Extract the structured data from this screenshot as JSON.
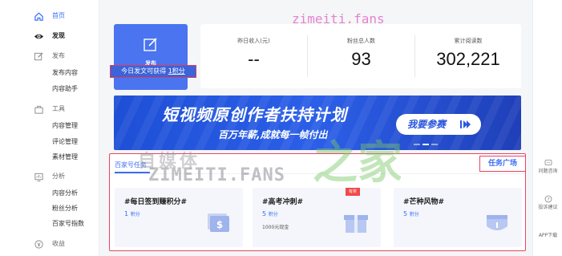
{
  "sidebar": {
    "items": [
      {
        "label": "首页",
        "icon": "home-icon",
        "style": "active"
      },
      {
        "label": "发现",
        "icon": "eye-icon",
        "style": "bold"
      },
      {
        "label": "发布",
        "icon": "edit-icon",
        "style": "head"
      },
      {
        "label": "发布内容",
        "style": "sub"
      },
      {
        "label": "内容助手",
        "style": "sub"
      },
      {
        "label": "工具",
        "icon": "briefcase-icon",
        "style": "head"
      },
      {
        "label": "内容管理",
        "style": "sub"
      },
      {
        "label": "评论管理",
        "style": "sub"
      },
      {
        "label": "素材管理",
        "style": "sub"
      },
      {
        "label": "分析",
        "icon": "chart-icon",
        "style": "head"
      },
      {
        "label": "内容分析",
        "style": "sub"
      },
      {
        "label": "粉丝分析",
        "style": "sub"
      },
      {
        "label": "百家号指数",
        "style": "sub"
      },
      {
        "label": "收益",
        "icon": "coin-icon",
        "style": "head"
      }
    ]
  },
  "publish": {
    "label": "发布",
    "banner_text": "今日发文可获得",
    "banner_points": "1积分"
  },
  "stats": [
    {
      "label": "昨日收入(元)",
      "value": "--"
    },
    {
      "label": "粉丝总人数",
      "value": "93"
    },
    {
      "label": "累计阅读数",
      "value": "302,221"
    }
  ],
  "promo": {
    "title": "短视频原创作者扶持计划",
    "subtitle": "百万年薪,成就每一帧付出",
    "button": "我要参赛"
  },
  "tasks": {
    "tab": "百家号任务",
    "square_label": "任务广场",
    "cards": [
      {
        "name": "#每日签到赚积分#",
        "points": "1",
        "unit": "积分",
        "extra": "",
        "badge": ""
      },
      {
        "name": "#高考冲刺#",
        "points": "5",
        "unit": "积分",
        "extra": "1000元现金",
        "badge": "有奖"
      },
      {
        "name": "#芒种风物#",
        "points": "5",
        "unit": "积分",
        "extra": "",
        "badge": ""
      }
    ]
  },
  "rail": [
    {
      "label": "问题咨询",
      "icon": "chat-icon"
    },
    {
      "label": "投诉建议",
      "icon": "question-icon"
    },
    {
      "label": "APP下载",
      "icon": "app-icon"
    }
  ],
  "watermarks": {
    "top": "zimeiti.fans",
    "cn": "自媒体",
    "jia": "之家",
    "big": "ZIMEITI.FANS"
  },
  "colors": {
    "accent": "#3b6ef5",
    "publish_card": "#4a74f0",
    "highlight_border": "#e94461",
    "badge": "#f04a4a"
  }
}
